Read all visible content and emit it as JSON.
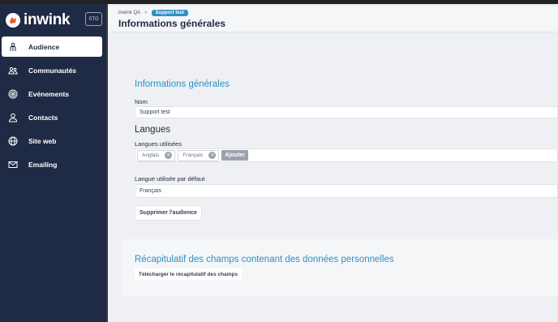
{
  "app": {
    "logo_text": "inwink",
    "env_badge": "STG"
  },
  "sidebar": {
    "items": [
      {
        "label": "Audience",
        "icon": "audience-icon",
        "active": true
      },
      {
        "label": "Communautés",
        "icon": "community-icon",
        "active": false
      },
      {
        "label": "Evénements",
        "icon": "events-icon",
        "active": false
      },
      {
        "label": "Contacts",
        "icon": "contacts-icon",
        "active": false
      },
      {
        "label": "Site web",
        "icon": "globe-icon",
        "active": false
      },
      {
        "label": "Emailing",
        "icon": "email-icon",
        "active": false
      }
    ]
  },
  "header": {
    "breadcrumb": {
      "root": "inwink QA",
      "separator": ">",
      "current": "Support test"
    },
    "title": "Informations générales"
  },
  "general": {
    "section_title": "Informations générales",
    "name_label": "Nom",
    "name_value": "Support test",
    "languages_title": "Langues",
    "languages_label": "Langues utilisées",
    "languages": [
      "Anglais",
      "Français"
    ],
    "add_label": "Ajouter",
    "default_language_label": "Langue utilisée par défaut",
    "default_language_value": "Français",
    "delete_label": "Supprimer l'audience"
  },
  "personal_data": {
    "section_title": "Récapitulatif des champs contenant des données personnelles",
    "download_label": "Télécharger le récapitulatif des champs"
  },
  "colors": {
    "sidebar_bg": "#1f2a44",
    "accent": "#2f8fc1",
    "page_bg": "#eef0f3"
  }
}
